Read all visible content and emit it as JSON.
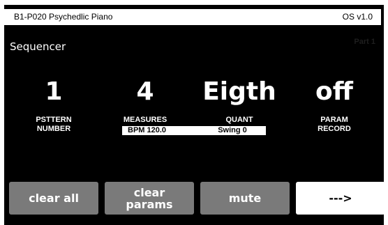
{
  "statusbar": {
    "title": "B1-P020 Psychedlic Piano",
    "os": "OS v1.0"
  },
  "header": {
    "title": "Sequencer",
    "part": "Part 1"
  },
  "params": [
    {
      "value": "1",
      "label1": "PSTTERN",
      "label2": "NUMBER"
    },
    {
      "value": "4",
      "label1": "MEASURES"
    },
    {
      "value": "Eigth",
      "label1": "QUANT"
    },
    {
      "value": "off",
      "label1": "PARAM",
      "label2": "RECORD"
    }
  ],
  "fields": {
    "bpm": "BPM 120.0",
    "swing": "Swing 0"
  },
  "buttons": [
    {
      "label": "clear all"
    },
    {
      "label": "clear params"
    },
    {
      "label": "mute"
    },
    {
      "label": "--->"
    }
  ]
}
